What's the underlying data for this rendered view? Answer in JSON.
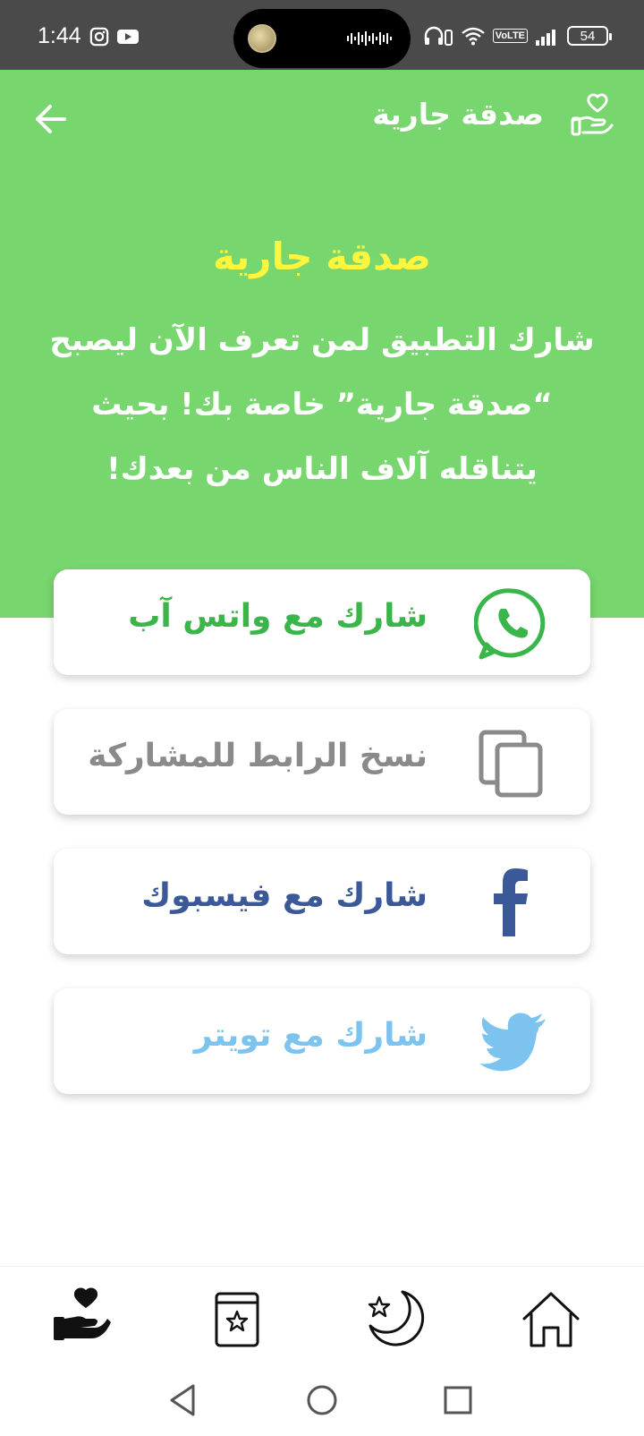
{
  "status_bar": {
    "time": "1:44",
    "volte": "VoLTE",
    "battery": "54"
  },
  "header": {
    "title": "صدقة جارية",
    "back_icon": "arrow-left-icon",
    "app_icon": "heart-hand-icon"
  },
  "hero": {
    "title": "صدقة جارية",
    "body": "شارك التطبيق لمن تعرف الآن ليصبح “صدقة جارية” خاصة بك! بحيث يتناقله آلاف الناس من بعدك!"
  },
  "share_options": [
    {
      "label": "شارك مع واتس آب",
      "icon": "whatsapp-icon",
      "color": "#3ab54a"
    },
    {
      "label": "نسخ الرابط للمشاركة",
      "icon": "copy-icon",
      "color": "#8a8a8a"
    },
    {
      "label": "شارك مع فيسبوك",
      "icon": "facebook-icon",
      "color": "#3b5998"
    },
    {
      "label": "شارك مع تويتر",
      "icon": "twitter-icon",
      "color": "#7cc3f0"
    }
  ],
  "bottom_nav": [
    {
      "icon": "heart-hand-icon",
      "active": true
    },
    {
      "icon": "book-star-icon",
      "active": false
    },
    {
      "icon": "moon-star-icon",
      "active": false
    },
    {
      "icon": "home-icon",
      "active": false
    }
  ],
  "colors": {
    "header_bg": "#78d66e",
    "hero_title": "#fff53c",
    "status_bar": "#4a4a4a"
  }
}
